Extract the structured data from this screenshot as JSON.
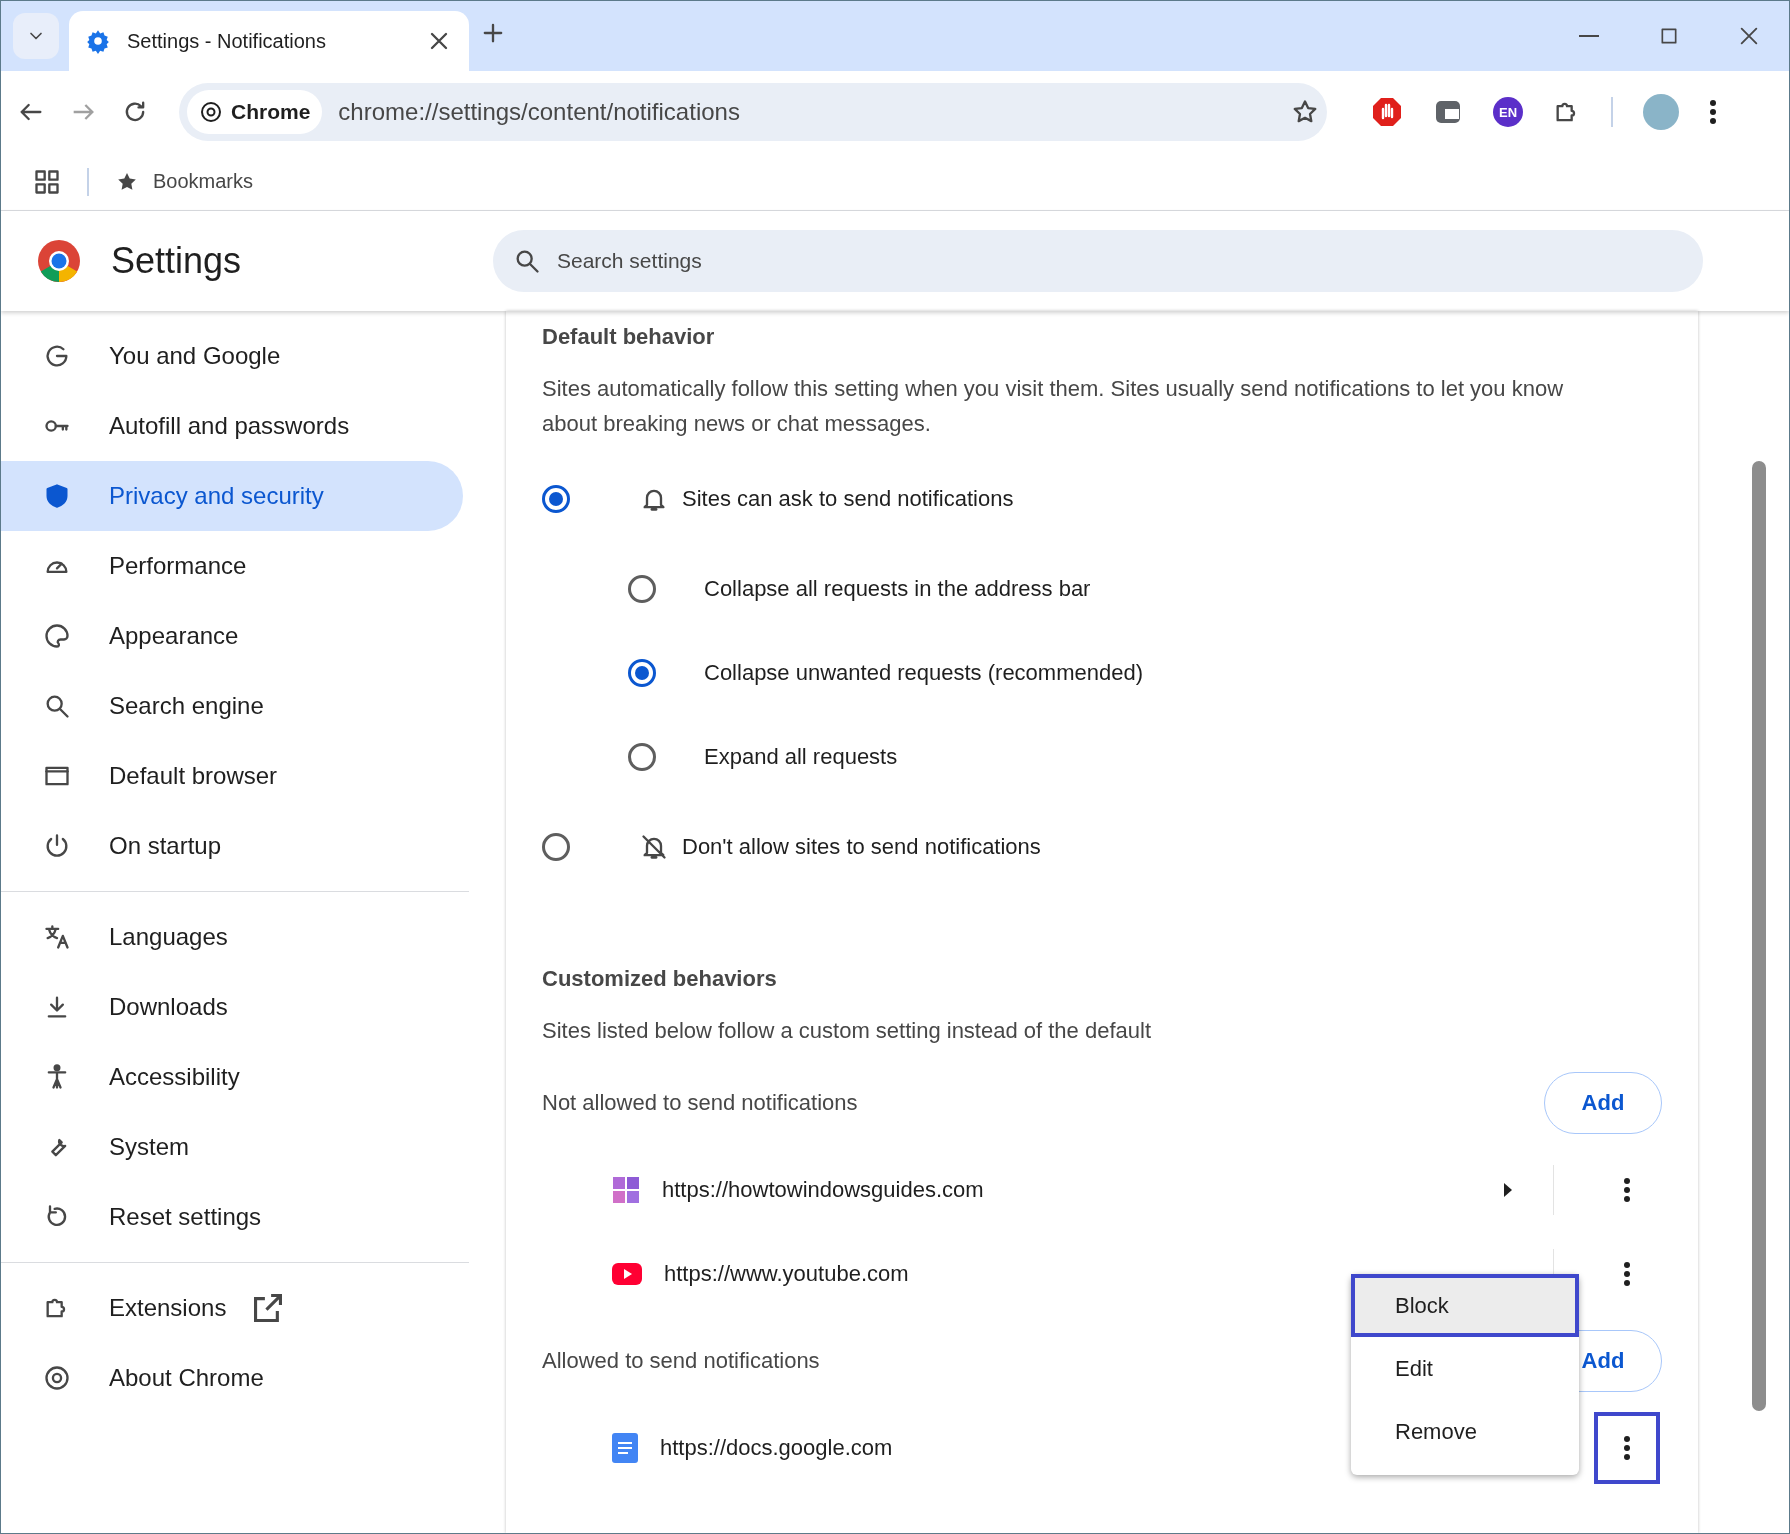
{
  "tab": {
    "title": "Settings - Notifications",
    "selected": true
  },
  "address": {
    "chip": "Chrome",
    "url": "chrome://settings/content/notifications"
  },
  "extension_badge": "EN",
  "bookmarks": {
    "label": "Bookmarks"
  },
  "header": {
    "title": "Settings",
    "search": {
      "placeholder": "Search settings"
    }
  },
  "sidebar": {
    "groups": [
      {
        "items": [
          {
            "label": "You and Google",
            "selected": false
          },
          {
            "label": "Autofill and passwords",
            "selected": false
          },
          {
            "label": "Privacy and security",
            "selected": true
          },
          {
            "label": "Performance",
            "selected": false
          },
          {
            "label": "Appearance",
            "selected": false
          },
          {
            "label": "Search engine",
            "selected": false
          },
          {
            "label": "Default browser",
            "selected": false
          },
          {
            "label": "On startup",
            "selected": false
          }
        ]
      },
      {
        "items": [
          {
            "label": "Languages",
            "selected": false
          },
          {
            "label": "Downloads",
            "selected": false
          },
          {
            "label": "Accessibility",
            "selected": false
          },
          {
            "label": "System",
            "selected": false
          },
          {
            "label": "Reset settings",
            "selected": false
          }
        ]
      },
      {
        "items": [
          {
            "label": "Extensions",
            "selected": false,
            "external": true
          },
          {
            "label": "About Chrome",
            "selected": false,
            "external": false
          }
        ]
      }
    ]
  },
  "default_behavior": {
    "heading": "Default behavior",
    "description": "Sites automatically follow this setting when you visit them. Sites usually send notifications to let you know about breaking news or chat messages.",
    "options": [
      {
        "label": "Sites can ask to send notifications",
        "selected": true,
        "children": [
          {
            "label": "Collapse all requests in the address bar",
            "selected": false
          },
          {
            "label": "Collapse unwanted requests (recommended)",
            "selected": true
          },
          {
            "label": "Expand all requests",
            "selected": false
          }
        ]
      },
      {
        "label": "Don't allow sites to send notifications",
        "selected": false
      }
    ]
  },
  "customized": {
    "heading": "Customized behaviors",
    "description": "Sites listed below follow a custom setting instead of the default",
    "lists": [
      {
        "label": "Not allowed to send notifications",
        "add": "Add",
        "sites": [
          {
            "url": "https://howtowindowsguides.com",
            "expandable": true,
            "annotated": false
          },
          {
            "url": "https://www.youtube.com",
            "expandable": false,
            "annotated": false
          }
        ]
      },
      {
        "label": "Allowed to send notifications",
        "add": "Add",
        "sites": [
          {
            "url": "https://docs.google.com",
            "expandable": false,
            "annotated": true
          }
        ]
      }
    ]
  },
  "menu": {
    "items": [
      {
        "label": "Block",
        "selected": true,
        "annotated": true
      },
      {
        "label": "Edit",
        "selected": false,
        "annotated": false
      },
      {
        "label": "Remove",
        "selected": false,
        "annotated": false
      }
    ]
  }
}
